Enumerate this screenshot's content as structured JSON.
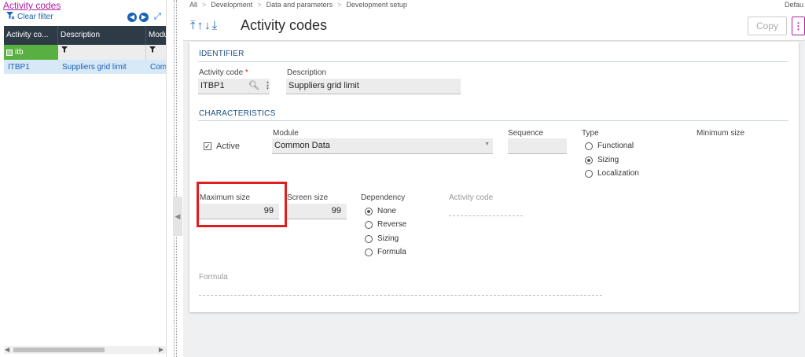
{
  "left_panel": {
    "title": "Activity codes",
    "clear_filter": "Clear filter",
    "columns": [
      "Activity co...",
      "Description",
      "Modu"
    ],
    "filter": {
      "code": "itb"
    },
    "rows": [
      {
        "code": "ITBP1",
        "description": "Suppliers grid limit",
        "module": "Com"
      }
    ]
  },
  "breadcrumb": [
    "All",
    "Development",
    "Data and parameters",
    "Development setup"
  ],
  "top_right": "Defau",
  "page_title": "Activity codes",
  "toolbar": {
    "copy": "Copy"
  },
  "identifier": {
    "section": "IDENTIFIER",
    "activity_code_label": "Activity code",
    "activity_code": "ITBP1",
    "description_label": "Description",
    "description": "Suppliers grid limit"
  },
  "characteristics": {
    "section": "CHARACTERISTICS",
    "active_label": "Active",
    "module_label": "Module",
    "module_value": "Common Data",
    "sequence_label": "Sequence",
    "type_label": "Type",
    "type_options": [
      "Functional",
      "Sizing",
      "Localization"
    ],
    "type_selected": "Sizing",
    "minimum_size_label": "Minimum size",
    "maximum_size_label": "Maximum size",
    "maximum_size": "99",
    "screen_size_label": "Screen size",
    "screen_size": "99",
    "dependency_label": "Dependency",
    "dependency_options": [
      "None",
      "Reverse",
      "Sizing",
      "Formula"
    ],
    "dependency_selected": "None",
    "activity_code_label": "Activity code",
    "formula_label": "Formula"
  },
  "colors": {
    "accent": "#1a63b5",
    "brand": "#b01ea6",
    "highlight": "#e01e1e",
    "filter_green": "#58b040"
  }
}
